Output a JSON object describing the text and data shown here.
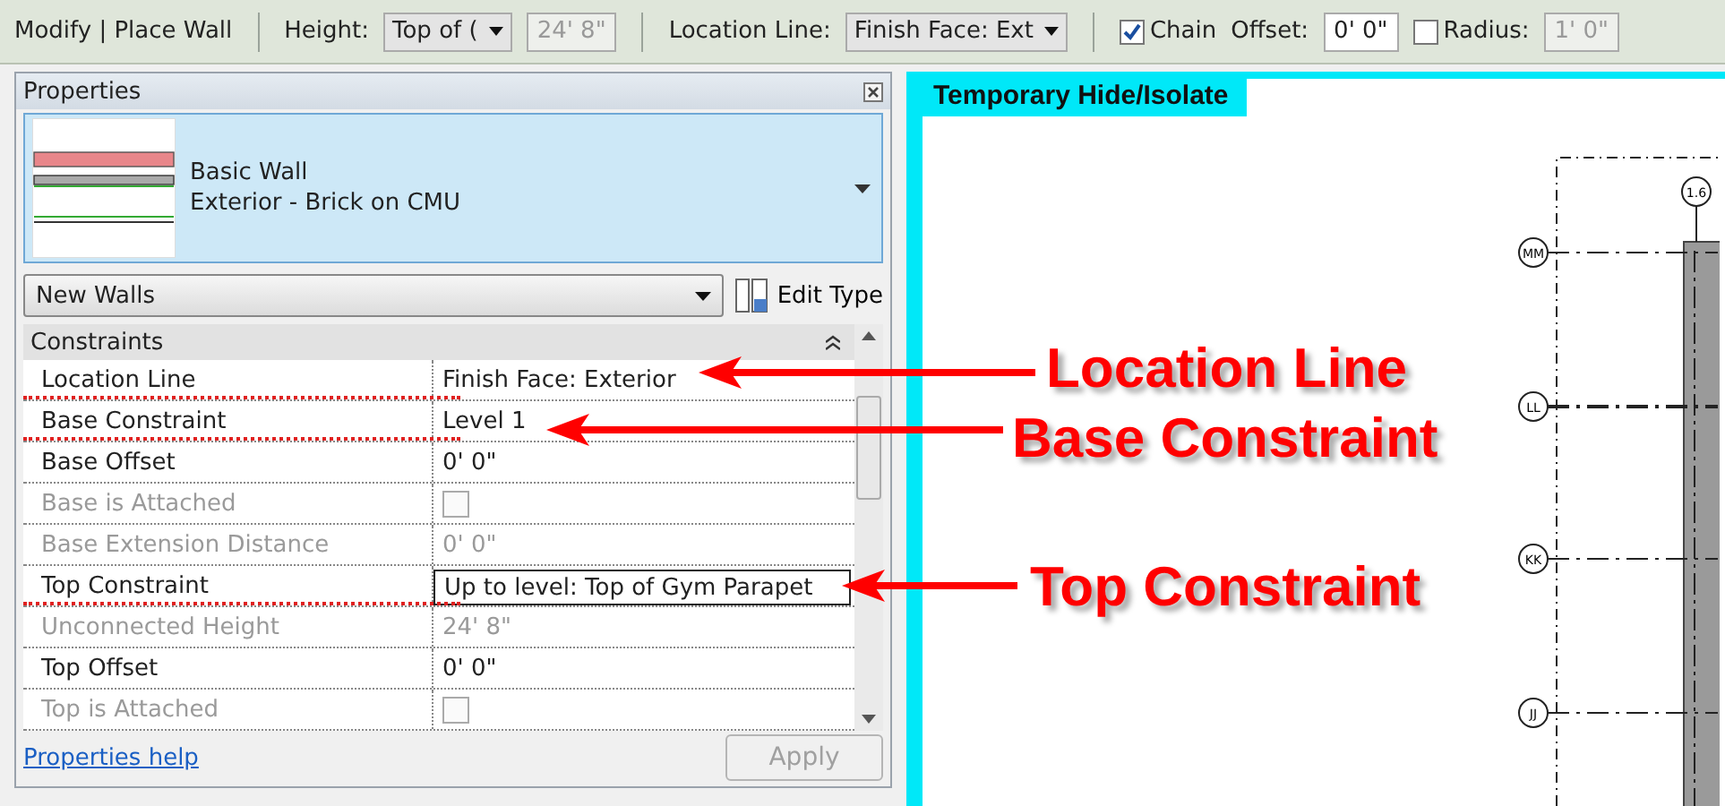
{
  "toolbar": [
    {
      "kind": "title",
      "text": "Modify | Place Wall"
    },
    {
      "kind": "separator"
    },
    {
      "kind": "label",
      "text": "Height:"
    },
    {
      "kind": "dropdown",
      "text": "Top of ("
    },
    {
      "kind": "readonly",
      "text": "24'  8\""
    },
    {
      "kind": "separator"
    },
    {
      "kind": "label",
      "text": "Location Line:"
    },
    {
      "kind": "dropdown",
      "text": "Finish Face: Ext"
    },
    {
      "kind": "separator"
    },
    {
      "kind": "checkbox",
      "text": "Chain",
      "checked": true
    },
    {
      "kind": "label",
      "text": "Offset:"
    },
    {
      "kind": "input",
      "text": "0'  0\""
    },
    {
      "kind": "checkbox",
      "text": "Radius:",
      "checked": false
    },
    {
      "kind": "readonly",
      "text": "1'  0\""
    }
  ],
  "properties": {
    "title": "Properties",
    "type_family": "Basic Wall",
    "type_name": "Exterior - Brick on CMU",
    "instance_filter": "New Walls",
    "edit_type": "Edit Type",
    "group": "Constraints",
    "rows": [
      {
        "name": "Location Line",
        "value": "Finish Face: Exterior",
        "kind": "text",
        "disabled": false,
        "underlined": true,
        "editing": false
      },
      {
        "name": "Base Constraint",
        "value": "Level 1",
        "kind": "text",
        "disabled": false,
        "underlined": true,
        "editing": false
      },
      {
        "name": "Base Offset",
        "value": "0'  0\"",
        "kind": "text",
        "disabled": false,
        "underlined": false,
        "editing": false
      },
      {
        "name": "Base is Attached",
        "kind": "checkbox",
        "checked": false,
        "disabled": true,
        "underlined": false,
        "editing": false
      },
      {
        "name": "Base Extension Distance",
        "value": "0'  0\"",
        "kind": "text",
        "disabled": true,
        "underlined": false,
        "editing": false
      },
      {
        "name": "Top Constraint",
        "value": "Up to level: Top of Gym Parapet",
        "kind": "text",
        "disabled": false,
        "underlined": true,
        "editing": true
      },
      {
        "name": "Unconnected Height",
        "value": "24'  8\"",
        "kind": "text",
        "disabled": true,
        "underlined": false,
        "editing": false
      },
      {
        "name": "Top Offset",
        "value": "0'  0\"",
        "kind": "text",
        "disabled": false,
        "underlined": false,
        "editing": false
      },
      {
        "name": "Top is Attached",
        "kind": "checkbox",
        "checked": false,
        "disabled": true,
        "underlined": false,
        "editing": false
      }
    ],
    "help_link": "Properties help",
    "apply": {
      "label": "Apply",
      "disabled": true
    }
  },
  "view": {
    "mode_label": "Temporary Hide/Isolate",
    "grid_bubbles": [
      "1.6",
      "MM",
      "LL",
      "KK",
      "JJ"
    ]
  },
  "callouts": [
    "Location Line",
    "Base Constraint",
    "Top Constraint"
  ]
}
